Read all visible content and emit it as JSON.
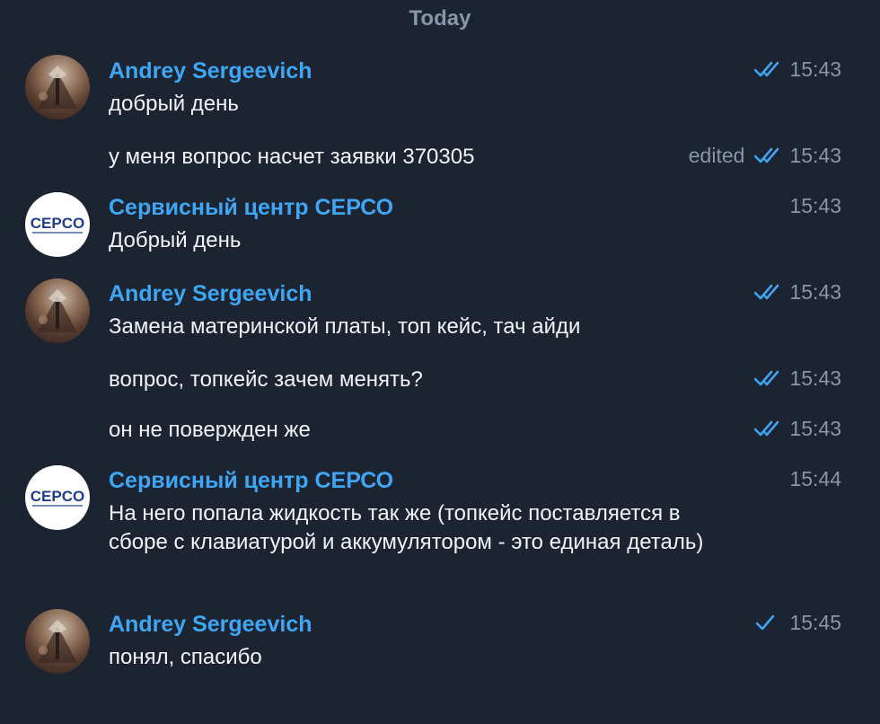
{
  "date_header": "Today",
  "colors": {
    "background": "#1c2431",
    "sender": "#3ea6f4",
    "text": "#f2f4f7",
    "meta": "#8796a8",
    "check": "#3ea6f4"
  },
  "messages": [
    {
      "sender": "Andrey Sergeevich",
      "text": "добрый день",
      "time": "15:43",
      "status": "read",
      "avatar": "photo-avatar"
    },
    {
      "text": "у меня вопрос насчет заявки 370305",
      "time": "15:43",
      "edited": "edited",
      "status": "read"
    },
    {
      "sender": "Сервисный центр СЕРСО",
      "text": "Добрый день",
      "time": "15:43",
      "avatar": "cepco-logo-avatar",
      "logo_text": "CEPCO"
    },
    {
      "sender": "Andrey Sergeevich",
      "text": "Замена материнской платы, топ кейс, тач айди",
      "time": "15:43",
      "status": "read",
      "avatar": "photo-avatar"
    },
    {
      "text": "вопрос, топкейс зачем менять?",
      "time": "15:43",
      "status": "read"
    },
    {
      "text": "он не повержден же",
      "time": "15:43",
      "status": "read"
    },
    {
      "sender": "Сервисный центр СЕРСО",
      "text": "На него попала жидкость так же (топкейс поставляется в сборе с клавиатурой и аккумулятором - это единая деталь)",
      "time": "15:44",
      "avatar": "cepco-logo-avatar",
      "logo_text": "CEPCO"
    },
    {
      "sender": "Andrey Sergeevich",
      "text": "понял, спасибо",
      "time": "15:45",
      "status": "sent",
      "avatar": "photo-avatar"
    }
  ]
}
